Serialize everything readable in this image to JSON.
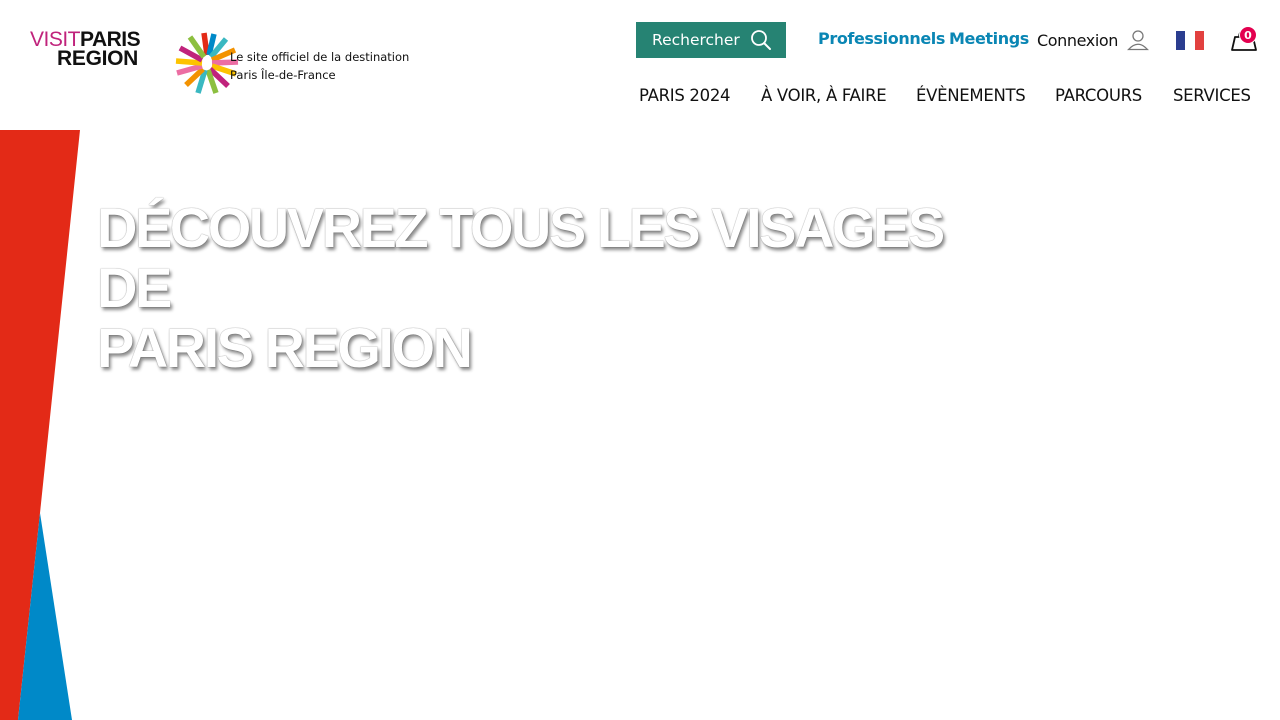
{
  "logo": {
    "visit": "VISIT",
    "paris": "PARIS",
    "region": "REGION"
  },
  "tagline": {
    "line1": "Le site officiel de la destination",
    "line2": "Paris Île-de-France"
  },
  "search": {
    "label": "Rechercher",
    "icon": "search-icon"
  },
  "top_links": {
    "professionnels": "Professionnels",
    "meetings": "Meetings",
    "connexion": "Connexion"
  },
  "cart": {
    "count": "0",
    "icon": "shopping-bag-icon"
  },
  "nav": {
    "items": [
      {
        "label": "PARIS 2024"
      },
      {
        "label": "À VOIR, À FAIRE"
      },
      {
        "label": "ÉVÈNEMENTS"
      },
      {
        "label": "PARCOURS"
      },
      {
        "label": "SERVICES"
      }
    ]
  },
  "hero": {
    "title_line1": "DÉCOUVREZ TOUS LES VISAGES DE",
    "title_line2": "PARIS REGION"
  },
  "colors": {
    "search_bg": "#268373",
    "link_blue": "#0a86b4",
    "badge": "#e3004f",
    "decor_red": "#e32a17",
    "decor_blue": "#0089c8",
    "flag_blue": "#2b3d8f",
    "flag_red": "#e2413f",
    "logo_magenta": "#c0237c"
  }
}
